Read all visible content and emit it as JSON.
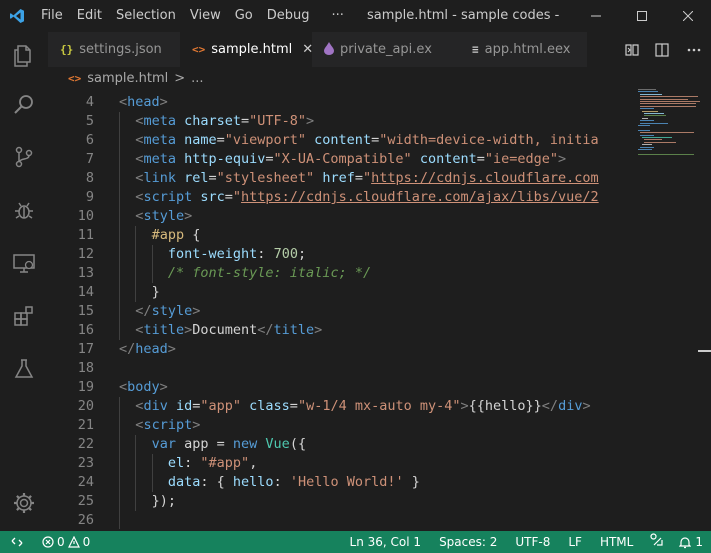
{
  "menu": [
    "File",
    "Edit",
    "Selection",
    "View",
    "Go",
    "Debug",
    "···"
  ],
  "window_title": "sample.html - sample codes - Visual Studio Code",
  "tabs": [
    {
      "label": "settings.json",
      "icon": "{}",
      "icon_color": "#cbcb41",
      "active": false
    },
    {
      "label": "sample.html",
      "icon": "<>",
      "icon_color": "#e37933",
      "active": true,
      "close": "✕"
    },
    {
      "label": "private_api.ex",
      "icon": "💧",
      "icon_color": "#a074c4",
      "active": false
    },
    {
      "label": "app.html.eex",
      "icon": "≡",
      "icon_color": "#cccccc",
      "active": false
    }
  ],
  "breadcrumb": {
    "icon": "<>",
    "file": "sample.html",
    "sep": ">",
    "more": "..."
  },
  "code_lines": [
    {
      "n": "4",
      "indent": 0
    },
    {
      "n": "5",
      "indent": 1
    },
    {
      "n": "6",
      "indent": 1
    },
    {
      "n": "7",
      "indent": 1
    },
    {
      "n": "8",
      "indent": 1
    },
    {
      "n": "9",
      "indent": 1
    },
    {
      "n": "10",
      "indent": 1
    },
    {
      "n": "11",
      "indent": 2
    },
    {
      "n": "12",
      "indent": 3
    },
    {
      "n": "13",
      "indent": 3
    },
    {
      "n": "14",
      "indent": 2
    },
    {
      "n": "15",
      "indent": 1
    },
    {
      "n": "16",
      "indent": 1
    },
    {
      "n": "17",
      "indent": 0
    },
    {
      "n": "18",
      "indent": 0
    },
    {
      "n": "19",
      "indent": 0
    },
    {
      "n": "20",
      "indent": 1
    },
    {
      "n": "21",
      "indent": 1
    },
    {
      "n": "22",
      "indent": 2
    },
    {
      "n": "23",
      "indent": 3
    },
    {
      "n": "24",
      "indent": 3
    },
    {
      "n": "25",
      "indent": 2
    },
    {
      "n": "26",
      "indent": 1
    }
  ],
  "code": {
    "l4": [
      "<",
      "head",
      ">"
    ],
    "l5": [
      "<",
      "meta",
      " ",
      "charset",
      "=",
      "\"UTF-8\"",
      ">"
    ],
    "l6": [
      "<",
      "meta",
      " ",
      "name",
      "=",
      "\"viewport\"",
      " ",
      "content",
      "=",
      "\"width=device-width, initia"
    ],
    "l7": [
      "<",
      "meta",
      " ",
      "http-equiv",
      "=",
      "\"X-UA-Compatible\"",
      " ",
      "content",
      "=",
      "\"ie=edge\"",
      ">"
    ],
    "l8": [
      "<",
      "link",
      " ",
      "rel",
      "=",
      "\"stylesheet\"",
      " ",
      "href",
      "=",
      "\"",
      "https://cdnjs.cloudflare.com"
    ],
    "l9": [
      "<",
      "script",
      " ",
      "src",
      "=",
      "\"",
      "https://cdnjs.cloudflare.com/ajax/libs/vue/2"
    ],
    "l10": [
      "<",
      "style",
      ">"
    ],
    "l11": [
      "#app",
      " {"
    ],
    "l12": [
      "font-weight",
      ": ",
      "700",
      ";"
    ],
    "l13": [
      "/* font-style: italic; */"
    ],
    "l14": [
      "}"
    ],
    "l15": [
      "</",
      "style",
      ">"
    ],
    "l16": [
      "<",
      "title",
      ">",
      "Document",
      "</",
      "title",
      ">"
    ],
    "l17": [
      "</",
      "head",
      ">"
    ],
    "l19": [
      "<",
      "body",
      ">"
    ],
    "l20": [
      "<",
      "div",
      " ",
      "id",
      "=",
      "\"app\"",
      " ",
      "class",
      "=",
      "\"w-1/4 mx-auto my-4\"",
      ">",
      "{{hello}}",
      "</",
      "div",
      ">"
    ],
    "l21": [
      "<",
      "script",
      ">"
    ],
    "l22": [
      "var",
      " app = ",
      "new",
      " ",
      "Vue",
      "({"
    ],
    "l23": [
      "el",
      ": ",
      "\"#app\"",
      ","
    ],
    "l24": [
      "data",
      ": { ",
      "hello",
      ": ",
      "'Hello World!'",
      " }"
    ],
    "l25": [
      "});"
    ]
  },
  "status": {
    "remote_icon": "><",
    "errors": "0",
    "warnings": "0",
    "cursor": "Ln 36, Col 1",
    "spaces": "Spaces: 2",
    "encoding": "UTF-8",
    "eol": "LF",
    "language": "HTML",
    "notifications": "1"
  },
  "colors": {
    "statusbar": "#16825d",
    "editor_bg": "#1e1e1e",
    "accent": "#007acc"
  }
}
